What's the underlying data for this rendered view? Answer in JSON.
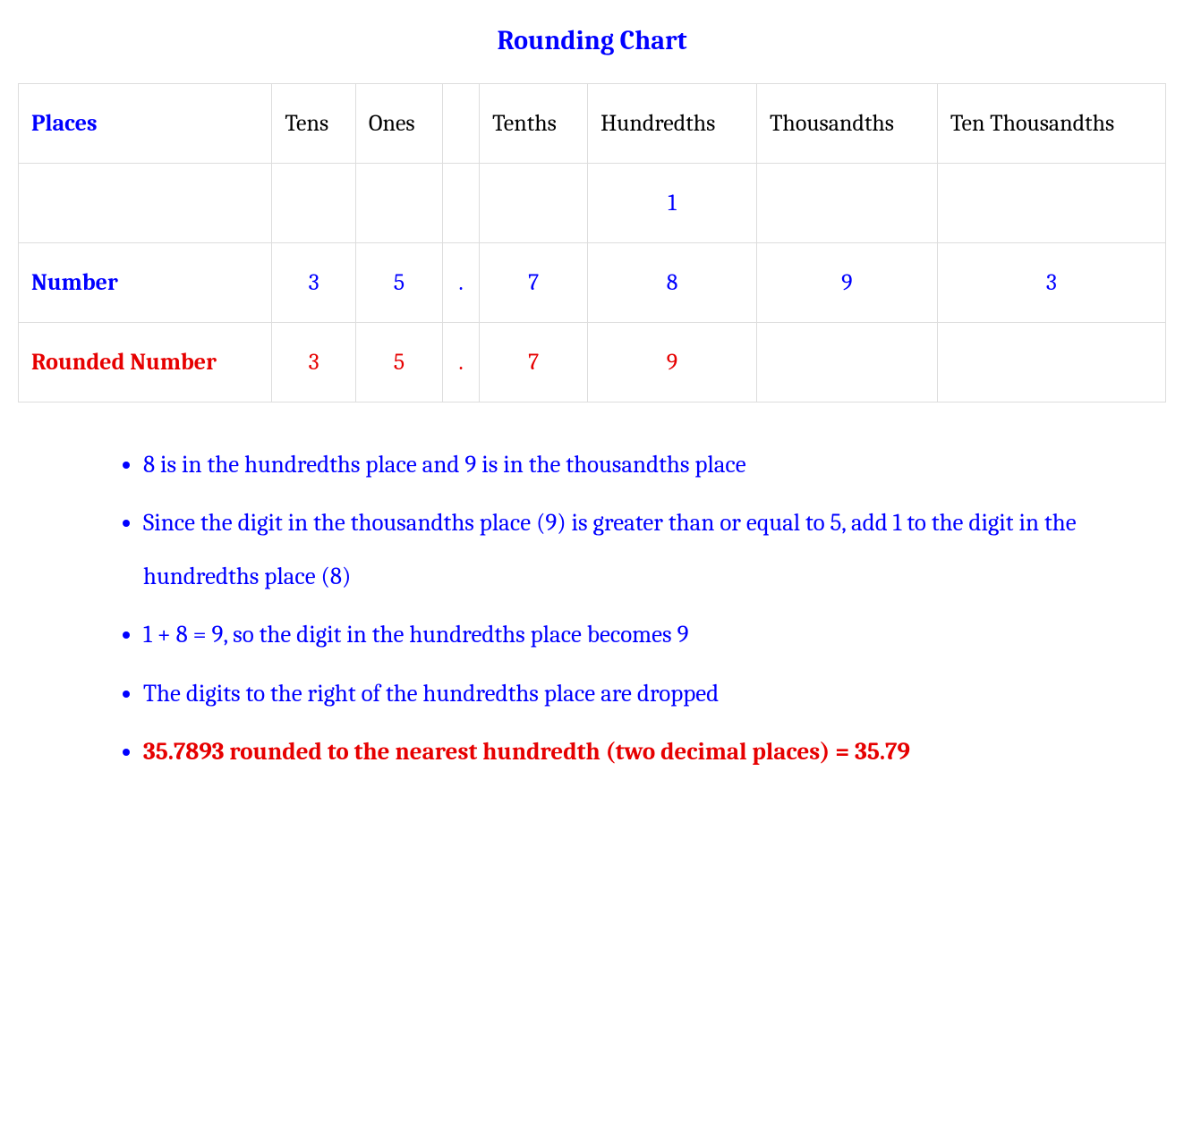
{
  "title": "Rounding Chart",
  "table": {
    "places_label": "Places",
    "headers": [
      "Tens",
      "Ones",
      "",
      "Tenths",
      "Hundredths",
      "Thousandths",
      "Ten Thousandths"
    ],
    "carry": [
      "",
      "",
      "",
      "",
      "1",
      "",
      ""
    ],
    "number_label": "Number",
    "number": [
      "3",
      "5",
      ".",
      "7",
      "8",
      "9",
      "3"
    ],
    "rounded_label": "Rounded Number",
    "rounded": [
      "3",
      "5",
      ".",
      "7",
      "9",
      "",
      ""
    ]
  },
  "bullets": [
    "8 is in the hundredths place and 9 is in the thousandths place",
    "Since the digit in the thousandths place (9) is greater than or equal to 5, add 1 to the digit in the hundredths place (8)",
    "1 + 8 = 9, so the digit in the hundredths place becomes 9",
    "The digits to the right of the hundredths place are dropped",
    "35.7893 rounded to the nearest hundredth (two decimal places) = 35.79"
  ]
}
